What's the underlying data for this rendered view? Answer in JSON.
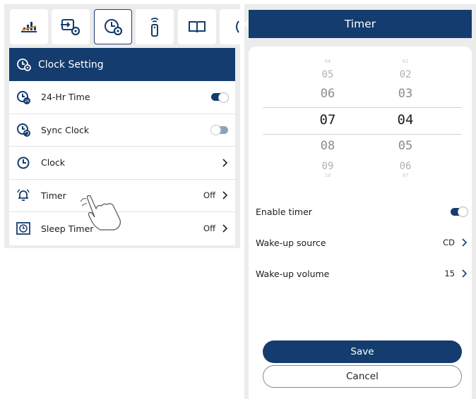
{
  "left_panel": {
    "tabs": [
      {
        "icon": "equalizer-icon"
      },
      {
        "icon": "input-settings-icon"
      },
      {
        "icon": "clock-settings-icon",
        "active": true
      },
      {
        "icon": "remote-icon"
      },
      {
        "icon": "book-icon"
      },
      {
        "icon": "partial-icon"
      }
    ],
    "header": {
      "title": "Clock Setting"
    },
    "rows": [
      {
        "label": "24-Hr Time",
        "control": "toggle-on"
      },
      {
        "label": "Sync Clock",
        "control": "toggle-off"
      },
      {
        "label": "Clock",
        "control": "chevron"
      },
      {
        "label": "Timer",
        "value": "Off",
        "control": "chevron"
      },
      {
        "label": "Sleep Timer",
        "value": "Off",
        "control": "chevron"
      }
    ]
  },
  "timer_screen": {
    "title": "Timer",
    "picker": {
      "hours": [
        "04",
        "05",
        "06",
        "07",
        "08",
        "09",
        "10"
      ],
      "minutes": [
        "01",
        "02",
        "03",
        "04",
        "05",
        "06",
        "07"
      ],
      "selected_hour": "07",
      "selected_minute": "04"
    },
    "enable_timer": {
      "label": "Enable timer",
      "on": true
    },
    "wake_source": {
      "label": "Wake-up source",
      "value": "CD"
    },
    "wake_volume": {
      "label": "Wake-up volume",
      "value": "15"
    },
    "save_label": "Save",
    "cancel_label": "Cancel"
  },
  "colors": {
    "accent": "#143c6e",
    "background": "#ececec"
  }
}
